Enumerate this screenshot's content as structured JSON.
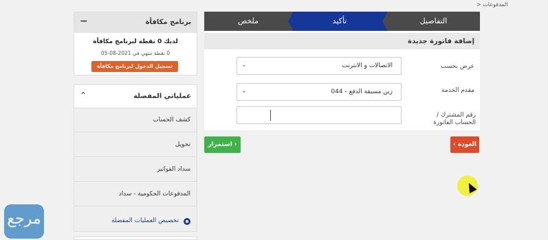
{
  "breadcrumb": "> المدفوعات",
  "steps": {
    "summary": "ملخص",
    "confirm": "تأكيد",
    "details": "التفاصيل"
  },
  "form": {
    "title": "إضافة فاتورة جديدة",
    "view_by_label": "عرض بحسب",
    "view_by_value": "الاتصالات و الانترنت",
    "provider_label": "مقدم الخدمة",
    "provider_value": "زين مسبقة الدفع - 044",
    "account_label": "رقم المشترك / الحساب الفاتورة",
    "account_value": ""
  },
  "buttons": {
    "continue": "استمرار",
    "back": "العودة"
  },
  "rewards": {
    "title": "برنامج مكافأة",
    "points": "لديك 0 نقطة لبرنامج مكافأة",
    "expiry": "0 نقطة تنتهي في 2021-08-05",
    "register": "تسجيل الدخول لبرنامج مكافأة"
  },
  "favorites": {
    "title": "عملياتي المفضلة",
    "items": [
      {
        "label": "كشف الحساب"
      },
      {
        "label": "تحويل"
      },
      {
        "label": "سداد الفواتير"
      },
      {
        "label": "المدفوعات الحكومية - سداد"
      }
    ],
    "customize": "تخصيص العمليات المفضلة"
  },
  "colors": {
    "active_step": "#16379a",
    "continue_button": "#3fb24a",
    "back_button": "#df4b2a",
    "rewards_button": "#e0622a"
  }
}
